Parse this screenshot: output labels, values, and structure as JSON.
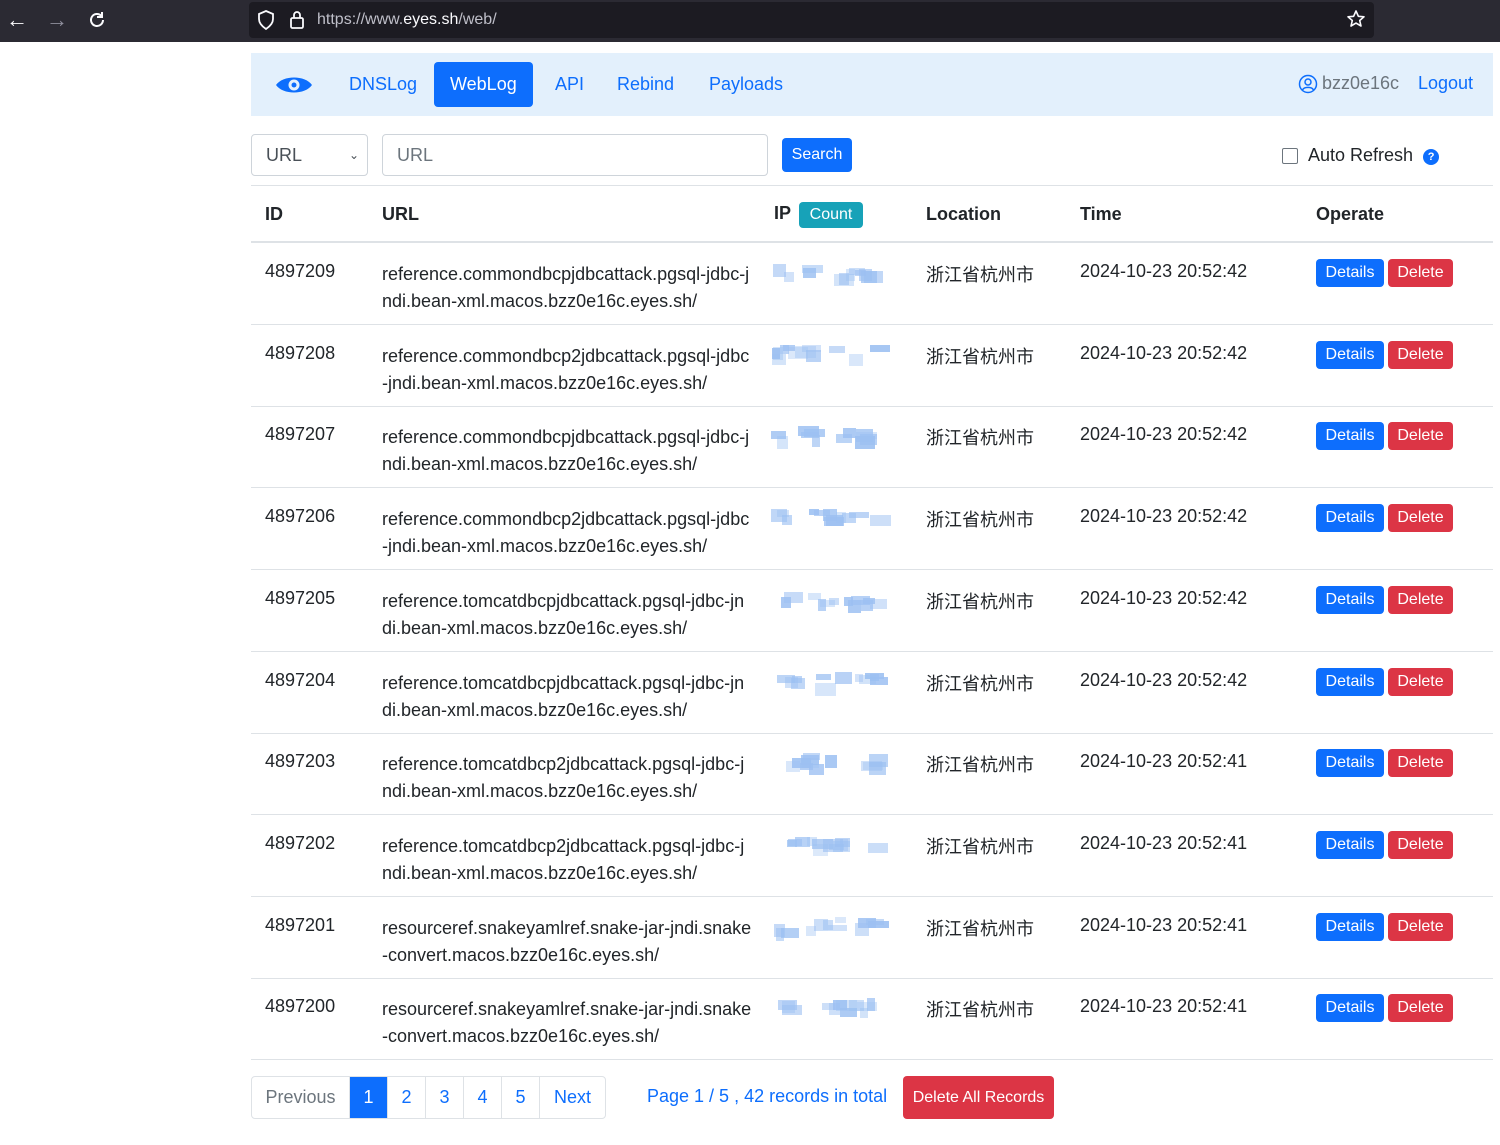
{
  "browser": {
    "url_prefix": "https://www.",
    "url_domain": "eyes.sh",
    "url_path": "/web/"
  },
  "nav": {
    "items": [
      "DNSLog",
      "WebLog",
      "API",
      "Rebind",
      "Payloads"
    ],
    "active": "WebLog",
    "username": "bzz0e16c",
    "logout": "Logout",
    "accent_color": "#0d6efd"
  },
  "search": {
    "select_value": "URL",
    "input_placeholder": "URL",
    "button": "Search",
    "auto_refresh": "Auto Refresh",
    "auto_refresh_checked": false
  },
  "table": {
    "headers": {
      "id": "ID",
      "url": "URL",
      "ip": "IP",
      "count": "Count",
      "location": "Location",
      "time": "Time",
      "operate": "Operate"
    },
    "details_label": "Details",
    "delete_label": "Delete",
    "rows": [
      {
        "id": "4897209",
        "url": "reference.commondbcpjdbcattack.pgsql-jdbc-jndi.bean-xml.macos.bzz0e16c.eyes.sh/",
        "location": "浙江省杭州市",
        "time": "2024-10-23 20:52:42"
      },
      {
        "id": "4897208",
        "url": "reference.commondbcp2jdbcattack.pgsql-jdbc-jndi.bean-xml.macos.bzz0e16c.eyes.sh/",
        "location": "浙江省杭州市",
        "time": "2024-10-23 20:52:42"
      },
      {
        "id": "4897207",
        "url": "reference.commondbcpjdbcattack.pgsql-jdbc-jndi.bean-xml.macos.bzz0e16c.eyes.sh/",
        "location": "浙江省杭州市",
        "time": "2024-10-23 20:52:42"
      },
      {
        "id": "4897206",
        "url": "reference.commondbcp2jdbcattack.pgsql-jdbc-jndi.bean-xml.macos.bzz0e16c.eyes.sh/",
        "location": "浙江省杭州市",
        "time": "2024-10-23 20:52:42"
      },
      {
        "id": "4897205",
        "url": "reference.tomcatdbcpjdbcattack.pgsql-jdbc-jndi.bean-xml.macos.bzz0e16c.eyes.sh/",
        "location": "浙江省杭州市",
        "time": "2024-10-23 20:52:42"
      },
      {
        "id": "4897204",
        "url": "reference.tomcatdbcpjdbcattack.pgsql-jdbc-jndi.bean-xml.macos.bzz0e16c.eyes.sh/",
        "location": "浙江省杭州市",
        "time": "2024-10-23 20:52:42"
      },
      {
        "id": "4897203",
        "url": "reference.tomcatdbcp2jdbcattack.pgsql-jdbc-jndi.bean-xml.macos.bzz0e16c.eyes.sh/",
        "location": "浙江省杭州市",
        "time": "2024-10-23 20:52:41"
      },
      {
        "id": "4897202",
        "url": "reference.tomcatdbcp2jdbcattack.pgsql-jdbc-jndi.bean-xml.macos.bzz0e16c.eyes.sh/",
        "location": "浙江省杭州市",
        "time": "2024-10-23 20:52:41"
      },
      {
        "id": "4897201",
        "url": "resourceref.snakeyamlref.snake-jar-jndi.snake-convert.macos.bzz0e16c.eyes.sh/",
        "location": "浙江省杭州市",
        "time": "2024-10-23 20:52:41"
      },
      {
        "id": "4897200",
        "url": "resourceref.snakeyamlref.snake-jar-jndi.snake-convert.macos.bzz0e16c.eyes.sh/",
        "location": "浙江省杭州市",
        "time": "2024-10-23 20:52:41"
      }
    ]
  },
  "pagination": {
    "previous": "Previous",
    "pages": [
      "1",
      "2",
      "3",
      "4",
      "5"
    ],
    "current": "1",
    "next": "Next",
    "info": "Page 1 / 5 , 42 records in total",
    "delete_all": "Delete All Records"
  }
}
